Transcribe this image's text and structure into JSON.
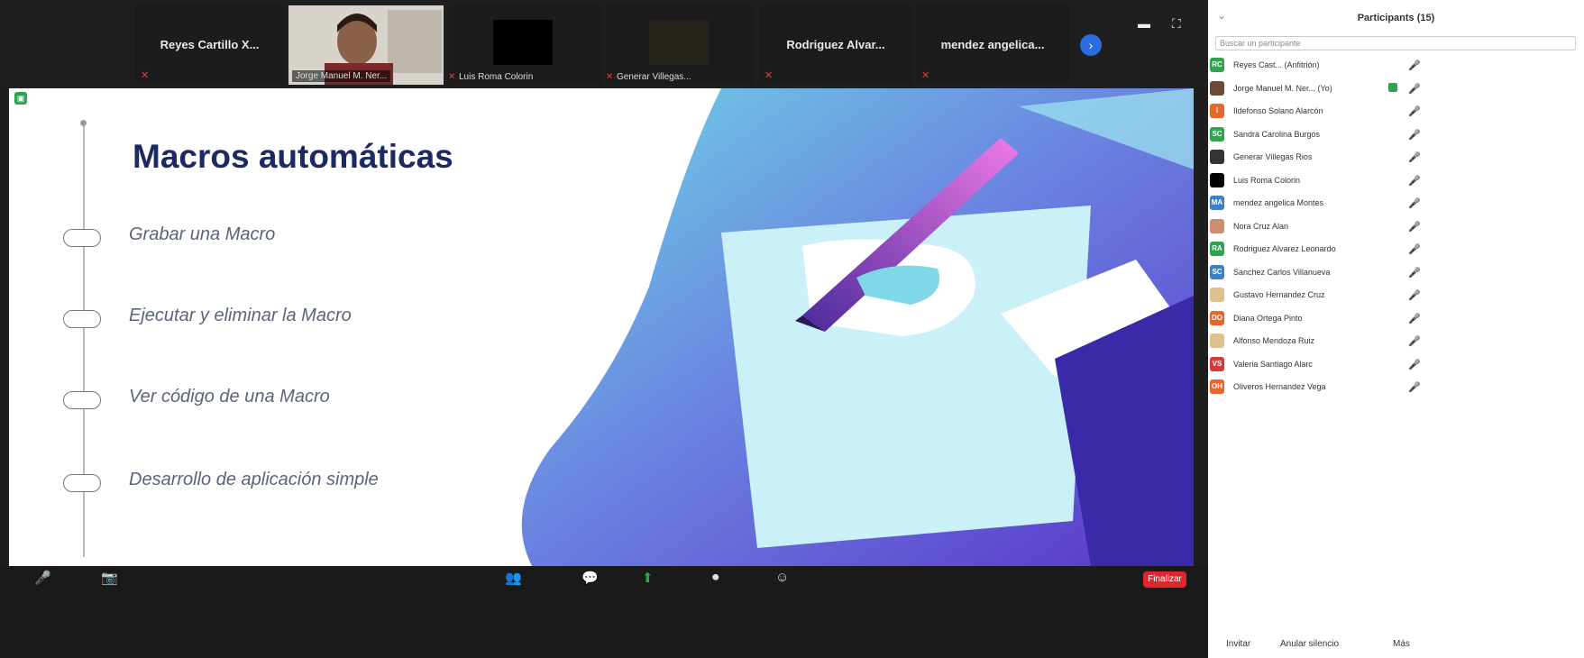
{
  "meeting": {
    "strip": [
      {
        "name": "Reyes Cartillo X...",
        "label": "",
        "type": "name",
        "muted": true
      },
      {
        "name": "",
        "label": "Jorge Manuel M. Ner...",
        "type": "video",
        "muted": false
      },
      {
        "name": "",
        "label": "Luis Roma Colorin",
        "type": "black",
        "muted": true
      },
      {
        "name": "",
        "label": "Generar Villegas...",
        "type": "dark",
        "muted": true
      },
      {
        "name": "Rodriguez Alvar...",
        "label": "",
        "type": "name",
        "muted": true
      },
      {
        "name": "mendez angelica...",
        "label": "",
        "type": "name",
        "muted": true
      }
    ],
    "next_icon": "chevron-right-icon",
    "view_icons": "▬ ⛶"
  },
  "slide": {
    "title": "Macros automáticas",
    "bullets": [
      "Grabar una Macro",
      "Ejecutar y eliminar la Macro",
      "Ver código de una Macro",
      "Desarrollo de aplicación simple"
    ],
    "colors": {
      "title": "#1c2a64",
      "text": "#5b6478"
    }
  },
  "toolbar": {
    "mute_icon": "🎤",
    "video_icon": "📷",
    "participants_icon": "👥",
    "chat_icon": "💬",
    "share_icon": "⬆",
    "record_icon": "⏺",
    "reactions_icon": "☺",
    "end_label": "Finalizar"
  },
  "panel": {
    "title": "Participants (15)",
    "collapse_icon": "⌄",
    "search_placeholder": "Buscar un participante",
    "participants": [
      {
        "initials": "RC",
        "color": "#2ea44f",
        "name": "Reyes Cast... (Anfitrión)",
        "video": false,
        "status": "🎤"
      },
      {
        "initials": "",
        "color": "#6b4b33",
        "name": "Jorge Manuel M. Ner... (Yo)",
        "video": true,
        "status": "🎤"
      },
      {
        "initials": "I",
        "color": "#e8672a",
        "name": "Ildefonso Solano Alarcón",
        "video": false,
        "status": "🎤"
      },
      {
        "initials": "SC",
        "color": "#2ea44f",
        "name": "Sandra Carolina Burgos",
        "video": false,
        "status": "🎤"
      },
      {
        "initials": "",
        "color": "#333333",
        "name": "Generar Villegas Rios",
        "video": false,
        "status": "🎤"
      },
      {
        "initials": "",
        "color": "#000000",
        "name": "Luis Roma Colorin",
        "video": false,
        "status": "🎤"
      },
      {
        "initials": "MA",
        "color": "#3d7fc9",
        "name": "mendez angelica Montes",
        "video": false,
        "status": "🎤"
      },
      {
        "initials": "",
        "color": "#c98f6e",
        "name": "Nora Cruz Alan",
        "video": false,
        "status": "🎤"
      },
      {
        "initials": "RA",
        "color": "#2ea44f",
        "name": "Rodriguez Alvarez Leonardo",
        "video": false,
        "status": "🎤"
      },
      {
        "initials": "SC",
        "color": "#3d7fc9",
        "name": "Sanchez Carlos Villanueva",
        "video": false,
        "status": "🎤"
      },
      {
        "initials": "",
        "color": "#e0c08c",
        "name": "Gustavo Hernandez Cruz",
        "video": false,
        "status": "🎤"
      },
      {
        "initials": "DO",
        "color": "#e8672a",
        "name": "Diana Ortega Pinto",
        "video": false,
        "status": "🎤"
      },
      {
        "initials": "",
        "color": "#e0c08c",
        "name": "Alfonso Mendoza Ruiz",
        "video": false,
        "status": "🎤"
      },
      {
        "initials": "VS",
        "color": "#d9383a",
        "name": "Valeria Santiago Alarc",
        "video": false,
        "status": "🎤"
      },
      {
        "initials": "OH",
        "color": "#e8672a",
        "name": "Oliveros Hernandez Vega",
        "video": false,
        "status": "🎤"
      }
    ],
    "footer": [
      "Invitar",
      "Anular silencio",
      "Más"
    ]
  }
}
